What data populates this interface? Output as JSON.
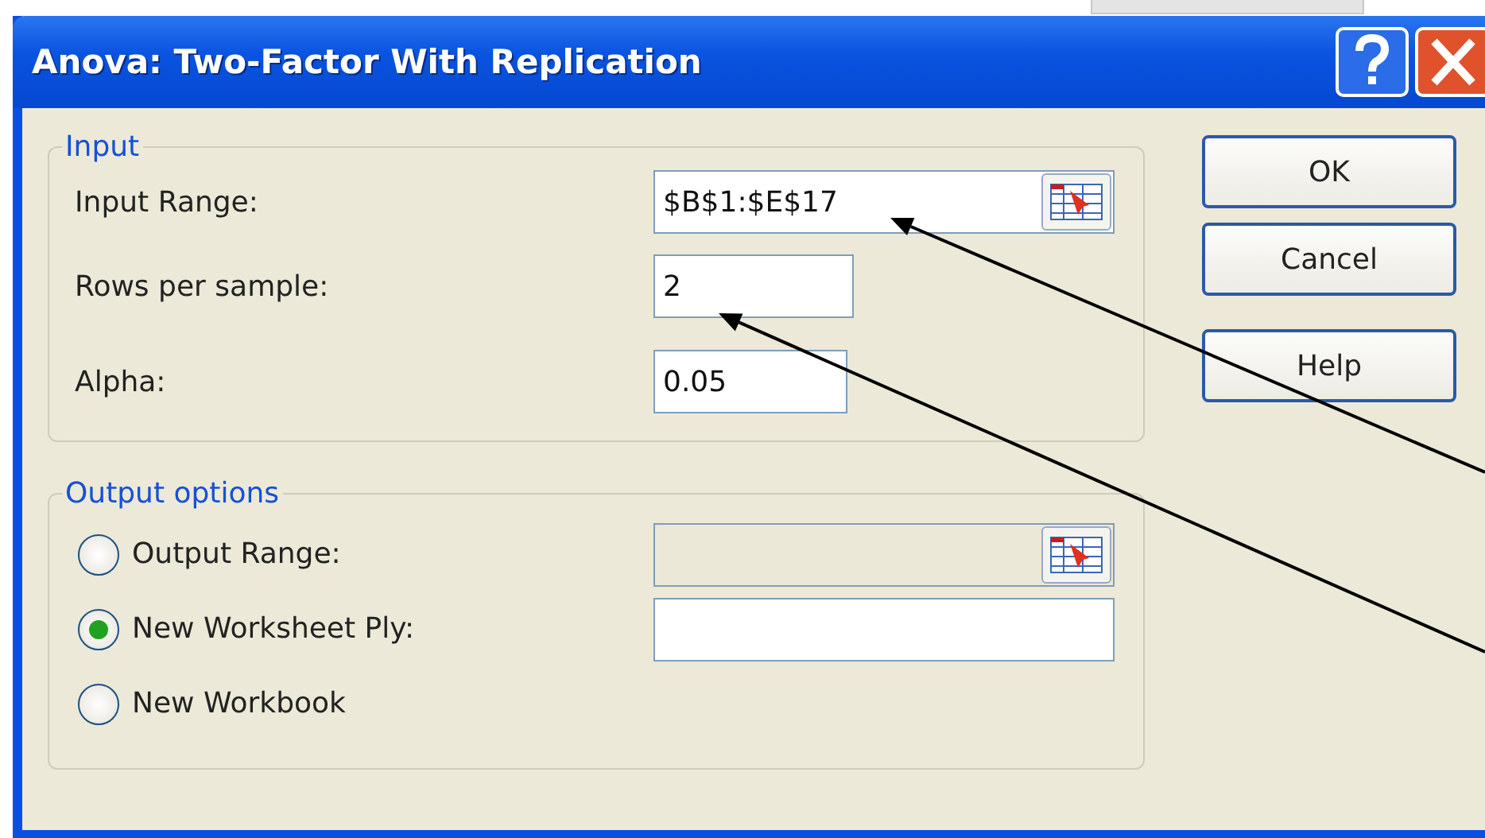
{
  "window": {
    "title": "Anova: Two-Factor With Replication"
  },
  "input": {
    "legend": "Input",
    "fields": [
      {
        "label": "Input Range:",
        "value": "$B$1:$E$17",
        "kind": "range"
      },
      {
        "label": "Rows per sample:",
        "value": "2",
        "kind": "short"
      },
      {
        "label": "Alpha:",
        "value": "0.05",
        "kind": "short"
      }
    ]
  },
  "output": {
    "legend": "Output options",
    "options": [
      {
        "label": "Output Range:",
        "selected": false,
        "field": {
          "kind": "range",
          "disabled": true
        }
      },
      {
        "label": "New Worksheet Ply:",
        "selected": true,
        "field": {
          "kind": "text",
          "disabled": false
        }
      },
      {
        "label": "New Workbook",
        "selected": false
      }
    ]
  },
  "buttons": [
    {
      "label": "OK"
    },
    {
      "label": "Cancel"
    },
    {
      "label": "Help"
    }
  ]
}
